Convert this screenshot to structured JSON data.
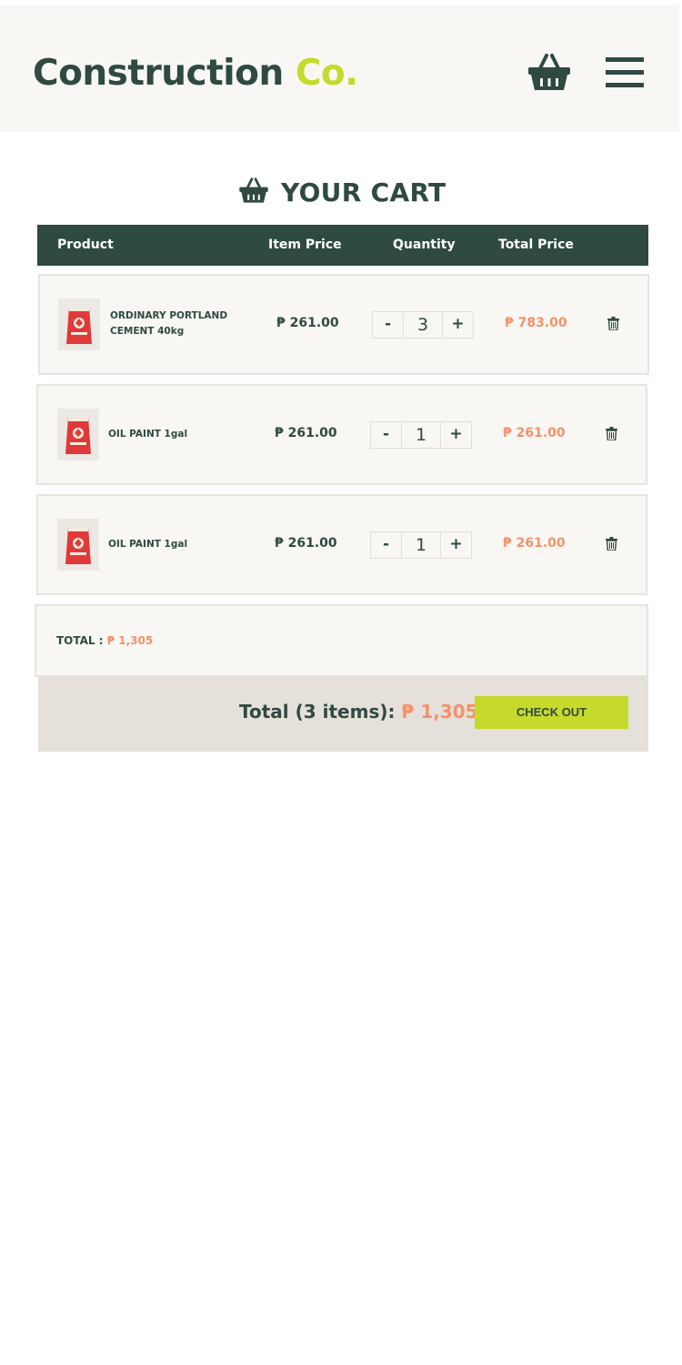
{
  "header": {
    "logo_part1": "Construction",
    "logo_part2": "Co.",
    "basket_icon": "basket-icon",
    "menu_icon": "hamburger-menu-icon"
  },
  "cart": {
    "title": "YOUR CART",
    "title_icon": "basket-icon"
  },
  "table": {
    "columns": [
      "Product",
      "Item Price",
      "Quantity",
      "Total Price"
    ]
  },
  "items": [
    {
      "name": "ORDINARY PORTLAND CEMENT 40kg",
      "item_price": "₱ 261.00",
      "quantity": "3",
      "minus_label": "-",
      "plus_label": "+",
      "total_price": "₱ 783.00"
    },
    {
      "name": "OIL PAINT 1gal",
      "item_price": "₱ 261.00",
      "quantity": "1",
      "minus_label": "-",
      "plus_label": "+",
      "total_price": "₱ 261.00"
    },
    {
      "name": "OIL PAINT 1gal",
      "item_price": "₱ 261.00",
      "quantity": "1",
      "minus_label": "-",
      "plus_label": "+",
      "total_price": "₱ 261.00"
    }
  ],
  "summary": {
    "total_label": "TOTAL :",
    "total_value": "₱ 1,305"
  },
  "footer": {
    "total_text": "Total (3 items):",
    "total_value": "₱ 1,305",
    "checkout_label": "CHECK OUT"
  },
  "colors": {
    "primary": "#2f4a40",
    "accent_lime": "#c5da2a",
    "price_orange": "#f4916a",
    "panel_bg": "#f8f7f4",
    "footer_bg": "#e5e0da"
  }
}
